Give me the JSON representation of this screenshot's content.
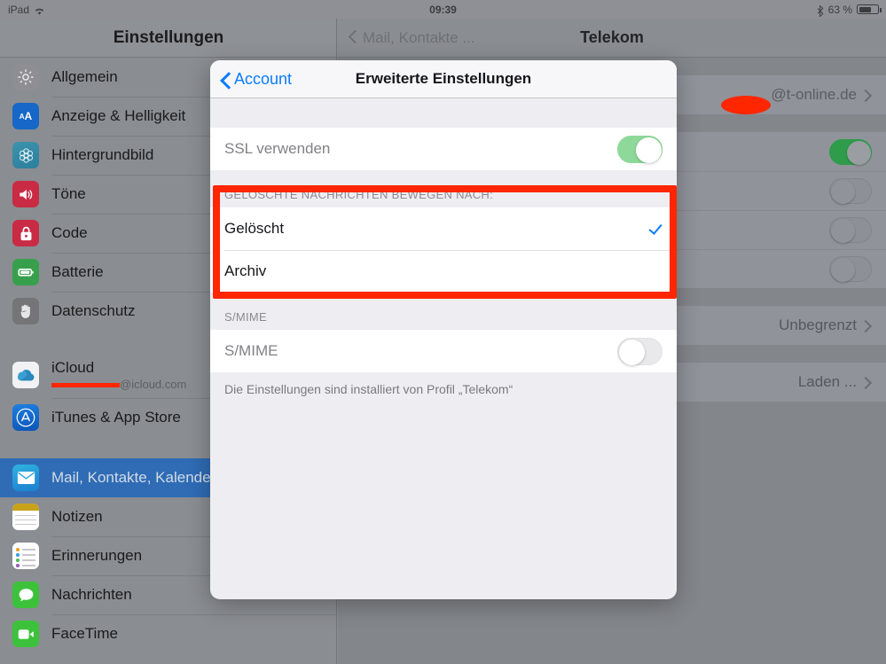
{
  "status_bar": {
    "device": "iPad",
    "wifi_icon": "wifi-icon",
    "time": "09:39",
    "bluetooth_icon": "bluetooth-icon",
    "battery_percent": "63 %",
    "battery_level": 63
  },
  "sidebar": {
    "title": "Einstellungen",
    "items": [
      {
        "label": "Allgemein",
        "icon": "gear-icon",
        "selected": false
      },
      {
        "label": "Anzeige & Helligkeit",
        "icon": "text-size-icon",
        "selected": false
      },
      {
        "label": "Hintergrundbild",
        "icon": "wallpaper-icon",
        "selected": false
      },
      {
        "label": "Töne",
        "icon": "speaker-icon",
        "selected": false
      },
      {
        "label": "Code",
        "icon": "lock-icon",
        "selected": false
      },
      {
        "label": "Batterie",
        "icon": "battery-icon",
        "selected": false
      },
      {
        "label": "Datenschutz",
        "icon": "hand-icon",
        "selected": false
      }
    ],
    "accounts": [
      {
        "label": "iCloud",
        "sublabel": "@icloud.com",
        "icon": "icloud-icon",
        "redacted": true
      },
      {
        "label": "iTunes & App Store",
        "icon": "app-store-icon",
        "redacted": false
      }
    ],
    "apps": [
      {
        "label": "Mail, Kontakte, Kalender",
        "icon": "mail-icon",
        "selected": true
      },
      {
        "label": "Notizen",
        "icon": "notes-icon",
        "selected": false
      },
      {
        "label": "Erinnerungen",
        "icon": "reminders-icon",
        "selected": false
      },
      {
        "label": "Nachrichten",
        "icon": "messages-icon",
        "selected": false
      },
      {
        "label": "FaceTime",
        "icon": "facetime-icon",
        "selected": false
      }
    ]
  },
  "detail": {
    "back_label": "Mail, Kontakte ...",
    "title": "Telekom",
    "account_email": "@t-online.de",
    "rows": [
      {
        "type": "toggle",
        "value": "on"
      },
      {
        "type": "toggle",
        "value": "off"
      },
      {
        "type": "toggle",
        "value": "off"
      },
      {
        "type": "toggle",
        "value": "off"
      }
    ],
    "value_rows": [
      {
        "value": "Unbegrenzt"
      },
      {
        "value": "Laden ..."
      }
    ]
  },
  "modal": {
    "back_label": "Account",
    "title": "Erweiterte Einstellungen",
    "ssl": {
      "label": "SSL verwenden",
      "state": "on"
    },
    "deleted_section": {
      "header": "GELÖSCHTE NACHRICHTEN BEWEGEN NACH:",
      "options": [
        {
          "label": "Gelöscht",
          "selected": true
        },
        {
          "label": "Archiv",
          "selected": false
        }
      ]
    },
    "smime_section": {
      "header": "S/MIME",
      "row_label": "S/MIME",
      "state": "off"
    },
    "footer": "Die Einstellungen sind installiert von Profil „Telekom“"
  },
  "annotation": {
    "color": "#ff2600",
    "shape": "rectangle-highlight"
  }
}
